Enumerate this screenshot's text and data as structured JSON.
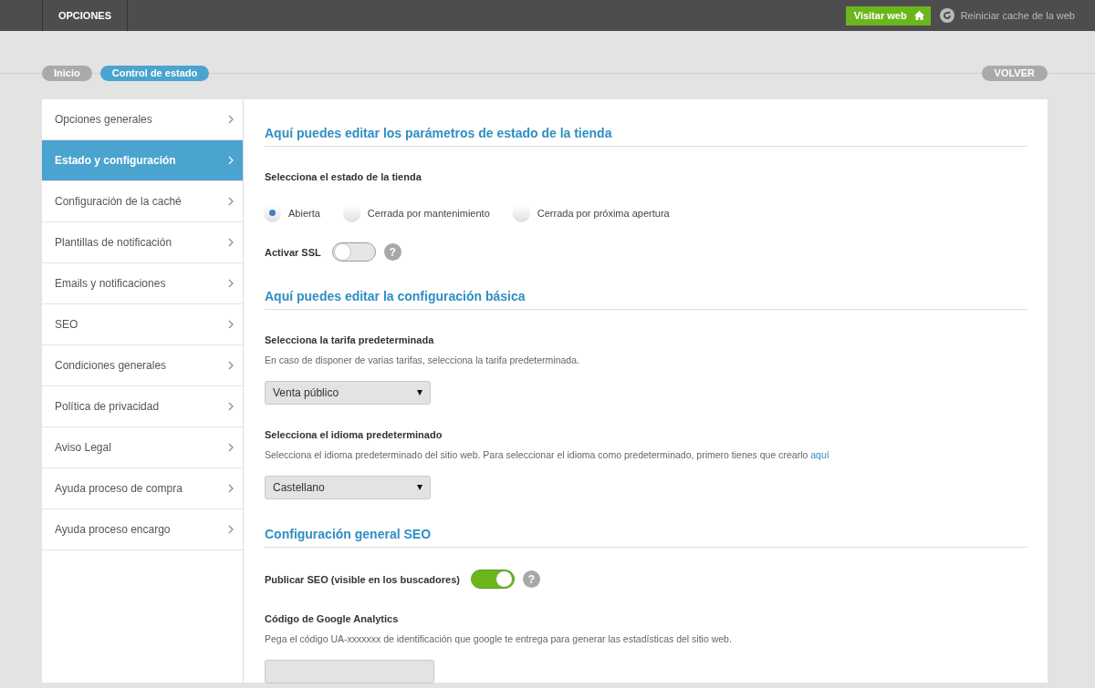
{
  "topbar": {
    "title": "OPCIONES",
    "visit_button": "Visitar web",
    "reset_link": "Reiniciar cache de la web"
  },
  "breadcrumbs": [
    {
      "label": "Inicio",
      "selected": false
    },
    {
      "label": "Control de estado",
      "selected": true
    }
  ],
  "back_button": "VOLVER",
  "sidebar": {
    "items": [
      {
        "label": "Opciones generales",
        "selected": false
      },
      {
        "label": "Estado y configuración",
        "selected": true
      },
      {
        "label": "Configuración de la caché",
        "selected": false
      },
      {
        "label": "Plantillas de notificación",
        "selected": false
      },
      {
        "label": "Emails y notificaciones",
        "selected": false
      },
      {
        "label": "SEO",
        "selected": false
      },
      {
        "label": "Condiciones generales",
        "selected": false
      },
      {
        "label": "Política de privacidad",
        "selected": false
      },
      {
        "label": "Aviso Legal",
        "selected": false
      },
      {
        "label": "Ayuda proceso de compra",
        "selected": false
      },
      {
        "label": "Ayuda proceso encargo",
        "selected": false
      }
    ]
  },
  "sections": [
    {
      "title": "Aquí puedes editar los parámetros de estado de la tienda",
      "fields": [
        {
          "kind": "radio",
          "label": "Selecciona el estado de la tienda",
          "options": [
            {
              "label": "Abierta",
              "selected": true
            },
            {
              "label": "Cerrada por mantenimiento",
              "selected": false
            },
            {
              "label": "Cerrada por próxima apertura",
              "selected": false
            }
          ]
        },
        {
          "kind": "toggle",
          "label": "Activar SSL",
          "on": false,
          "help": "?"
        }
      ]
    },
    {
      "title": "Aquí puedes editar la configuración básica",
      "fields": [
        {
          "kind": "select",
          "label": "Selecciona la tarifa predeterminada",
          "hint": "En caso de disponer de varias tarifas, selecciona la tarifa predeterminada.",
          "value": "Venta público"
        },
        {
          "kind": "select",
          "label": "Selecciona el idioma predeterminado",
          "hint": "Selecciona el idioma predeterminado del sitio web. Para seleccionar el idioma como predeterminado, primero tienes que crearlo",
          "link": "aquí",
          "value": "Castellano"
        }
      ]
    },
    {
      "title": "Configuración general SEO",
      "fields": [
        {
          "kind": "toggle",
          "label": "Publicar SEO (visible en los buscadores)",
          "on": true,
          "help": "?"
        },
        {
          "kind": "text",
          "label": "Código de Google Analytics",
          "hint": "Pega el código UA-xxxxxxx de identificación que google te entrega para generar las estadísticas del sitio web."
        }
      ]
    }
  ]
}
